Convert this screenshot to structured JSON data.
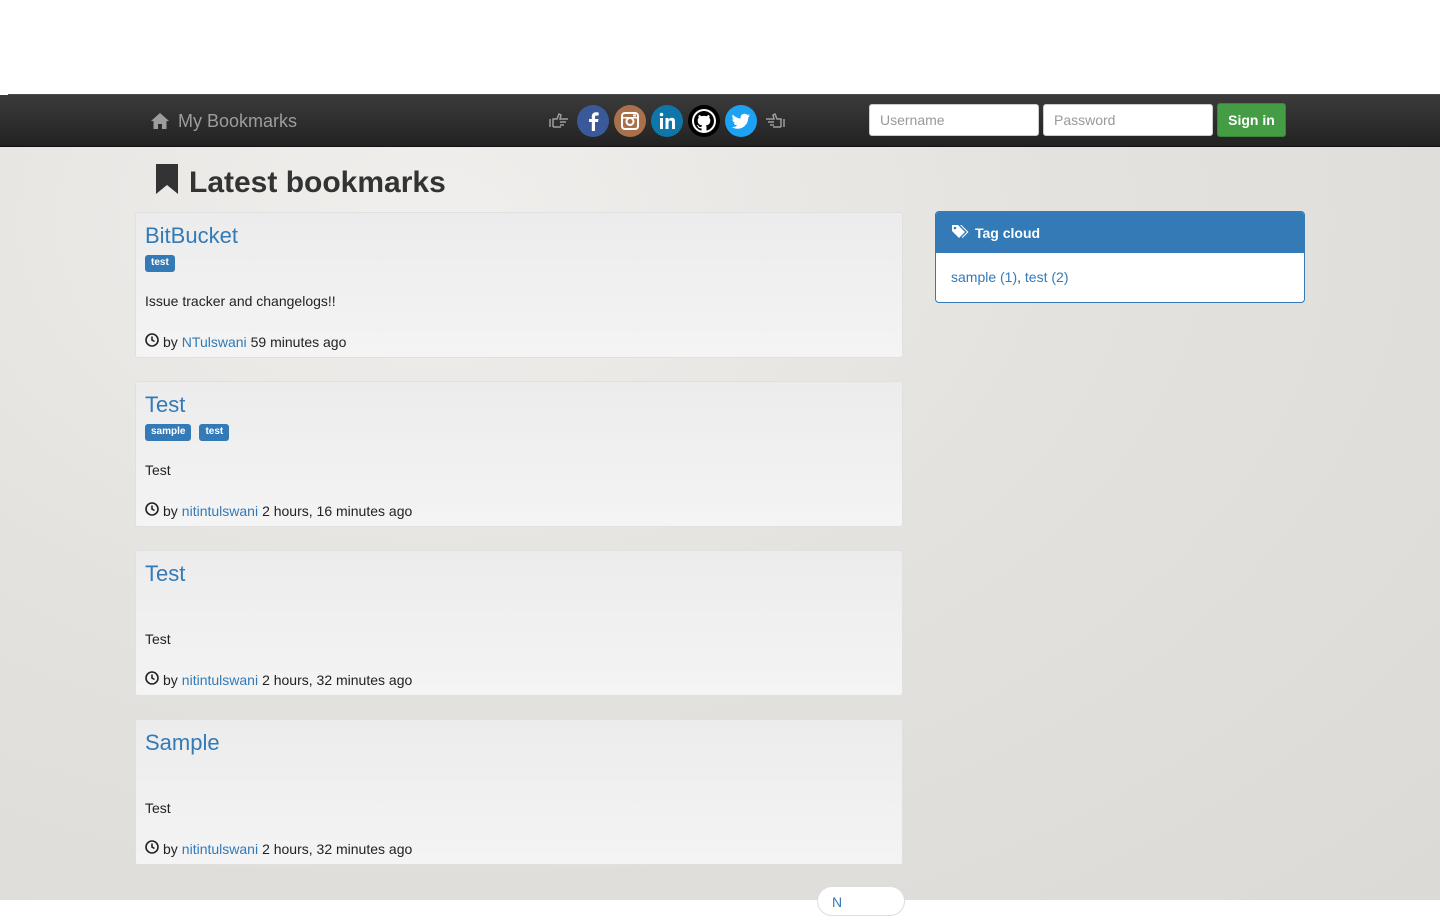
{
  "navbar": {
    "brand": "My Bookmarks",
    "social": [
      {
        "name": "facebook",
        "color": "#3b5998"
      },
      {
        "name": "instagram",
        "color": "#a9714b"
      },
      {
        "name": "linkedin",
        "color": "#0e76a8"
      },
      {
        "name": "github",
        "color": "#000000"
      },
      {
        "name": "twitter",
        "color": "#1da1f2"
      }
    ],
    "username_placeholder": "Username",
    "password_placeholder": "Password",
    "signin_label": "Sign in"
  },
  "page": {
    "title": "Latest bookmarks"
  },
  "bookmarks": [
    {
      "title": "BitBucket",
      "tags": [
        "test"
      ],
      "description": "Issue tracker and changelogs!!",
      "by": "by",
      "user": "NTulswani",
      "time": "59 minutes ago"
    },
    {
      "title": "Test",
      "tags": [
        "sample",
        "test"
      ],
      "description": "Test",
      "by": "by",
      "user": "nitintulswani",
      "time": "2 hours, 16 minutes ago"
    },
    {
      "title": "Test",
      "tags": [],
      "description": "Test",
      "by": "by",
      "user": "nitintulswani",
      "time": "2 hours, 32 minutes ago"
    },
    {
      "title": "Sample",
      "tags": [],
      "description": "Test",
      "by": "by",
      "user": "nitintulswani",
      "time": "2 hours, 32 minutes ago"
    }
  ],
  "tag_cloud": {
    "heading": "Tag cloud",
    "items": [
      "sample (1)",
      "test (2)"
    ],
    "separator": ", "
  },
  "pager": {
    "next_label": "N"
  },
  "colors": {
    "accent": "#337ab7",
    "success": "#449d44",
    "navbar": "#222222"
  }
}
